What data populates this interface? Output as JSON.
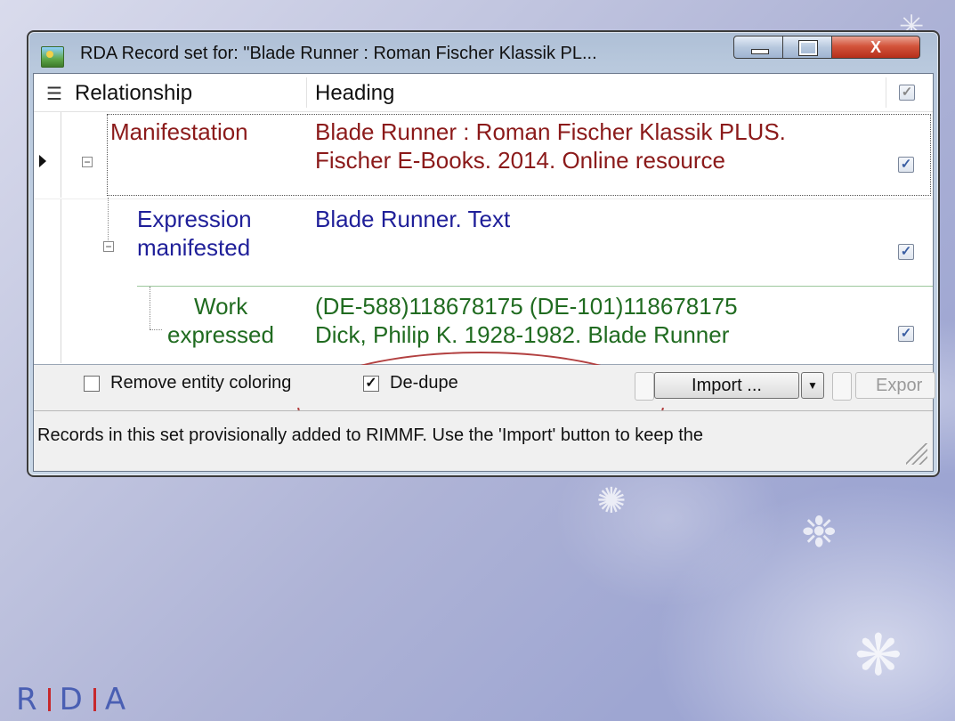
{
  "window": {
    "title": "RDA Record set for: \"Blade Runner : Roman  Fischer Klassik PL...",
    "close_label": "X"
  },
  "grid": {
    "columns": [
      "Relationship",
      "Heading"
    ],
    "rows": [
      {
        "relationship": "Manifestation",
        "heading_line1": "Blade Runner : Roman  Fischer Klassik PLUS.",
        "heading_line2": "Fischer E-Books. 2014. Online resource",
        "checked": true,
        "color": "#8b1a1a"
      },
      {
        "relationship_line1": "Expression",
        "relationship_line2": "manifested",
        "heading_line1": "Blade Runner. Text",
        "checked": true,
        "color": "#1f1f99"
      },
      {
        "relationship_line1": "Work",
        "relationship_line2": "expressed",
        "heading_line1": "(DE-588)118678175 (DE-101)118678175",
        "heading_line2": "Dick, Philip K. 1928-1982. Blade Runner",
        "checked": true,
        "color": "#206b20"
      }
    ]
  },
  "options": {
    "remove_coloring_label": "Remove entity coloring",
    "remove_coloring_checked": false,
    "dedupe_label": "De-dupe",
    "dedupe_checked": true,
    "import_label": "Import ...",
    "export_label": "Expor"
  },
  "status": {
    "text": "Records in this set provisionally added to RIMMF. Use the 'Import' button to keep the"
  },
  "logo": {
    "letters": [
      "R",
      "D",
      "A"
    ]
  }
}
